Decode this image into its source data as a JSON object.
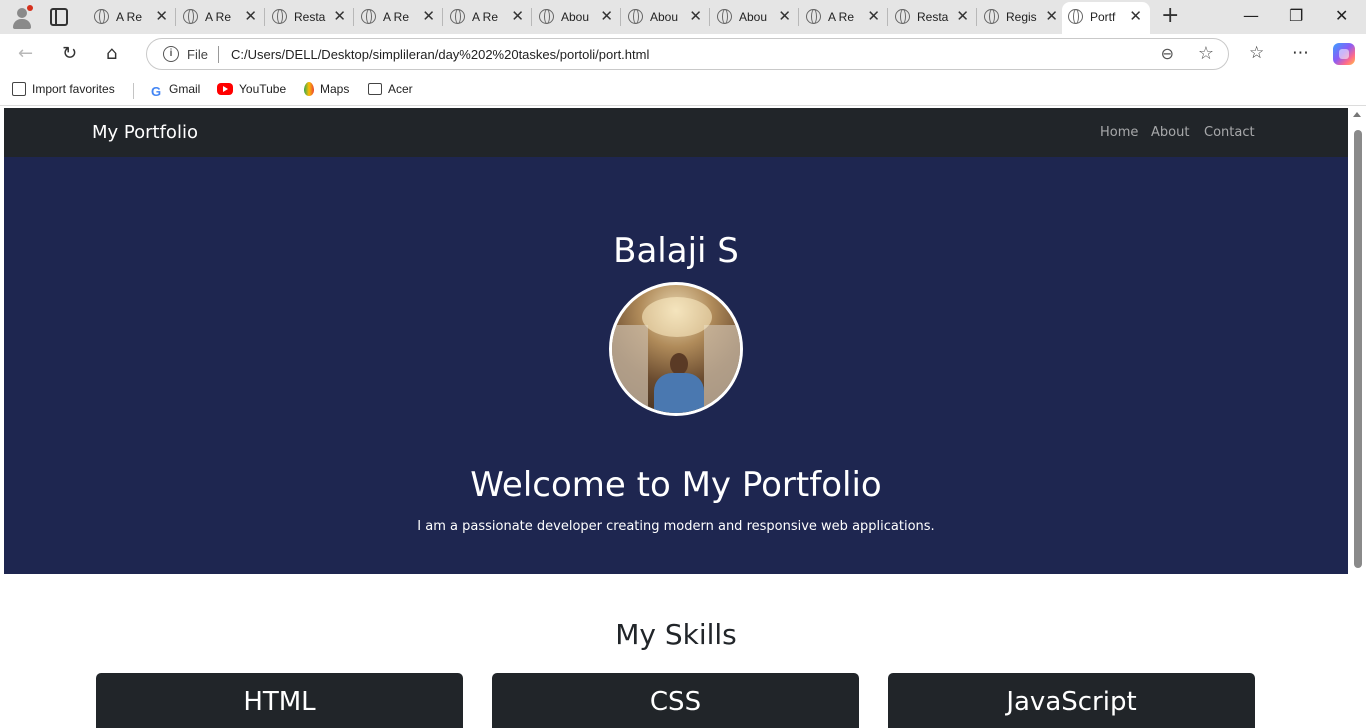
{
  "browser": {
    "tabs": [
      {
        "title": "A Re"
      },
      {
        "title": "A Re"
      },
      {
        "title": "Resta"
      },
      {
        "title": "A Re"
      },
      {
        "title": "A Re"
      },
      {
        "title": "Abou"
      },
      {
        "title": "Abou"
      },
      {
        "title": "Abou"
      },
      {
        "title": "A Re"
      },
      {
        "title": "Resta"
      },
      {
        "title": "Regis"
      },
      {
        "title": "Portf"
      }
    ],
    "address": {
      "scheme_label": "File",
      "url": "C:/Users/DELL/Desktop/simplileran/day%202%20taskes/portoli/port.html"
    },
    "favorites": [
      {
        "label": "Import favorites",
        "icon": "import-icon"
      },
      {
        "label": "Gmail",
        "icon": "gmail-icon"
      },
      {
        "label": "YouTube",
        "icon": "youtube-icon"
      },
      {
        "label": "Maps",
        "icon": "maps-icon"
      },
      {
        "label": "Acer",
        "icon": "folder-icon"
      }
    ]
  },
  "page": {
    "navbar": {
      "brand": "My Portfolio",
      "links": [
        "Home",
        "About",
        "Contact"
      ],
      "background": "#212529"
    },
    "hero": {
      "name": "Balaji S",
      "welcome": "Welcome to My Portfolio",
      "tagline": "I am a passionate developer creating modern and responsive web applications.",
      "background": "#1e2650"
    },
    "skills": {
      "title": "My Skills",
      "items": [
        "HTML",
        "CSS",
        "JavaScript"
      ]
    }
  }
}
